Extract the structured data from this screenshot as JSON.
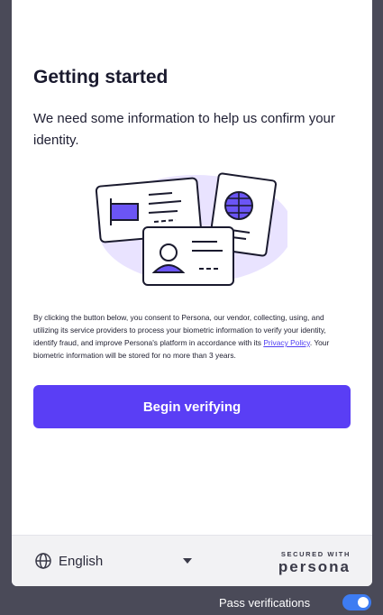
{
  "modal": {
    "title": "Getting started",
    "subtitle": "We need some information to help us confirm your identity.",
    "consent": {
      "text_before": "By clicking the button below, you consent to Persona, our vendor, collecting, using, and utilizing its service providers to process your biometric information to verify your identity, identify fraud, and improve Persona's platform in accordance with its ",
      "link_label": "Privacy Policy",
      "text_after": ". Your biometric information will be stored for no more than 3 years."
    },
    "cta_label": "Begin verifying"
  },
  "footer": {
    "language": "English",
    "brand_secured": "SECURED WITH",
    "brand_name": "persona"
  },
  "pass_verifications": {
    "label": "Pass verifications",
    "enabled": true
  },
  "colors": {
    "accent": "#5a3ef5",
    "toggle": "#3d7cf2",
    "backdrop": "#4a4a58"
  }
}
